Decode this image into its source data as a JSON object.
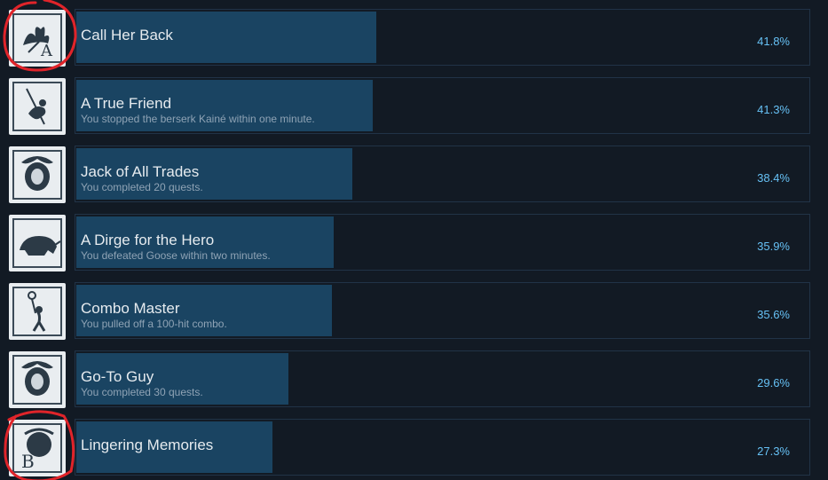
{
  "achievements": [
    {
      "title": "Call Her Back",
      "description": "",
      "percent": "41.8%",
      "percent_value": 41.8,
      "icon": "lily-a-icon"
    },
    {
      "title": "A True Friend",
      "description": "You stopped the berserk Kainé within one minute.",
      "percent": "41.3%",
      "percent_value": 41.3,
      "icon": "swordswoman-icon"
    },
    {
      "title": "Jack of All Trades",
      "description": "You completed 20 quests.",
      "percent": "38.4%",
      "percent_value": 38.4,
      "icon": "ornate-crest-icon"
    },
    {
      "title": "A Dirge for the Hero",
      "description": "You defeated Goose within two minutes.",
      "percent": "35.9%",
      "percent_value": 35.9,
      "icon": "boar-icon"
    },
    {
      "title": "Combo Master",
      "description": "You pulled off a 100-hit combo.",
      "percent": "35.6%",
      "percent_value": 35.6,
      "icon": "staff-fighter-icon"
    },
    {
      "title": "Go-To Guy",
      "description": "You completed 30 quests.",
      "percent": "29.6%",
      "percent_value": 29.6,
      "icon": "ornate-crest-icon"
    },
    {
      "title": "Lingering Memories",
      "description": "",
      "percent": "27.3%",
      "percent_value": 27.3,
      "icon": "crest-b-icon"
    }
  ],
  "colors": {
    "background": "#121a24",
    "panel_border": "#213347",
    "progress_bar": "#1a4462",
    "percent_text": "#66c0f4",
    "annotation_circle": "#e0242a"
  }
}
